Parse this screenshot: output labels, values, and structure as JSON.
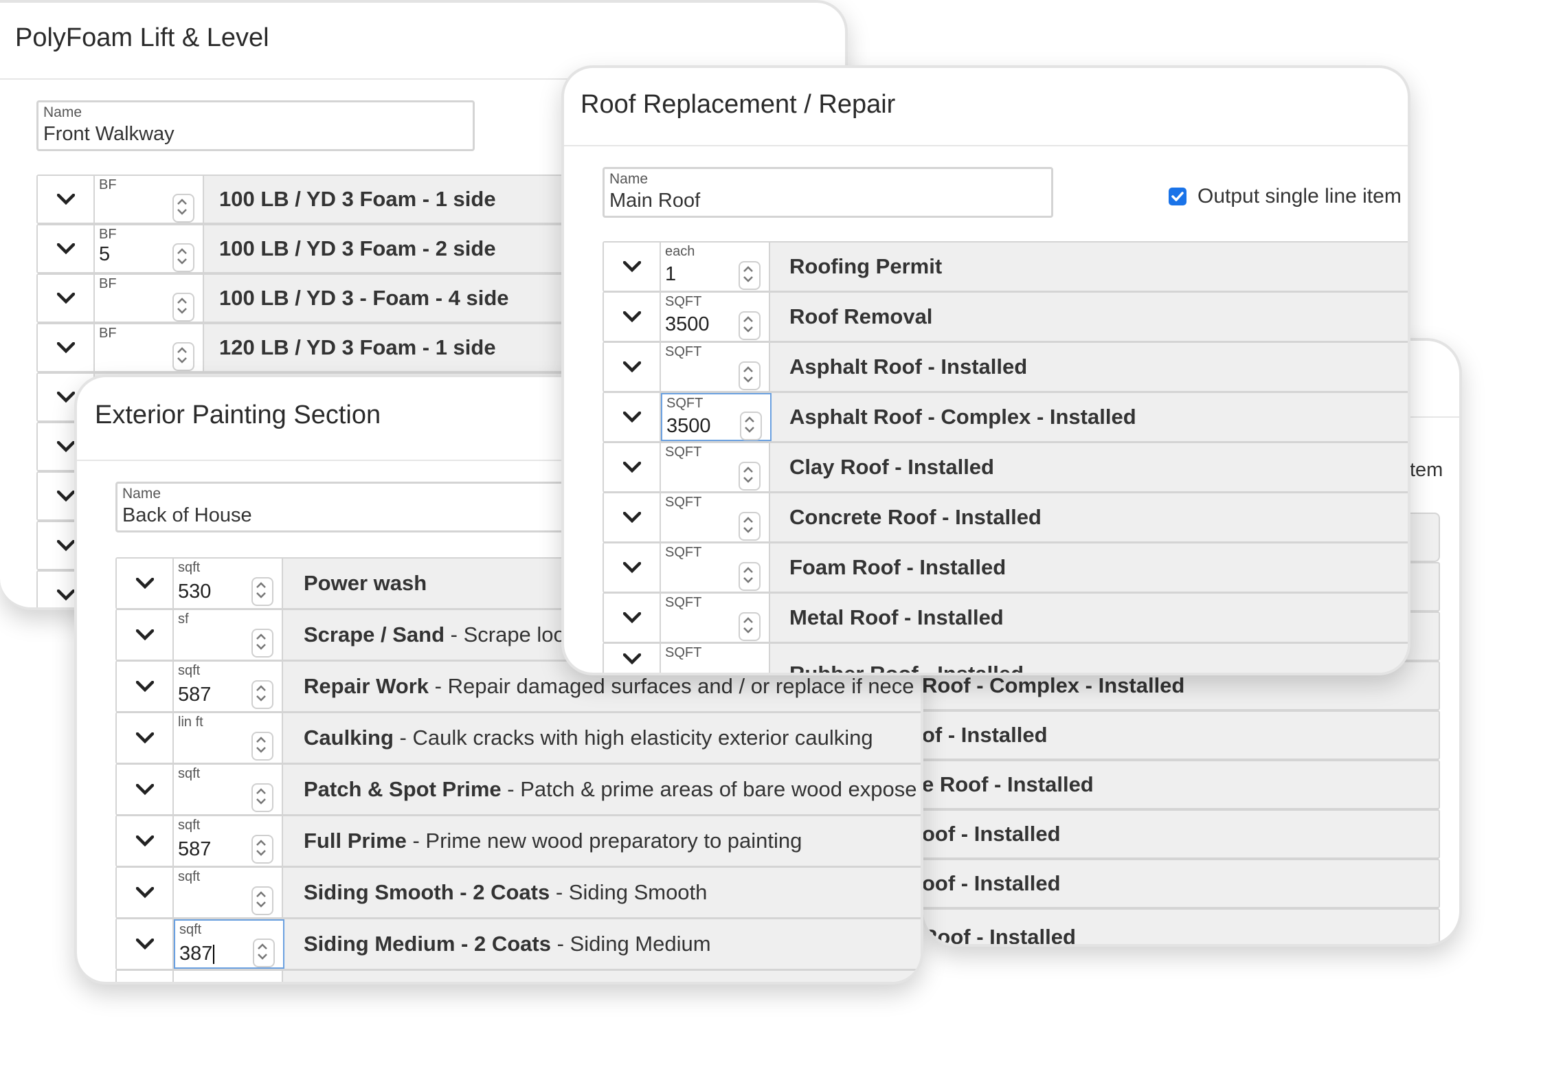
{
  "polyfoam": {
    "title": "PolyFoam Lift & Level",
    "name_label": "Name",
    "name_value": "Front Walkway",
    "rows": [
      {
        "unit": "BF",
        "value": "",
        "label": "100 LB / YD 3 Foam - 1 side"
      },
      {
        "unit": "BF",
        "value": "5",
        "label": "100 LB / YD 3 Foam - 2 side"
      },
      {
        "unit": "BF",
        "value": "",
        "label": "100 LB / YD 3 - Foam - 4 side"
      },
      {
        "unit": "BF",
        "value": "",
        "label": "120 LB / YD 3 Foam - 1 side"
      }
    ]
  },
  "painting": {
    "title": "Exterior Painting Section",
    "name_label": "Name",
    "name_value": "Back of House",
    "rows": [
      {
        "unit": "sqft",
        "value": "530",
        "title": "Power wash",
        "desc": ""
      },
      {
        "unit": "sf",
        "value": "",
        "title": "Scrape / Sand",
        "desc": " - Scrape loo"
      },
      {
        "unit": "sqft",
        "value": "587",
        "title": "Repair Work",
        "desc": " - Repair damaged surfaces and / or replace if nece"
      },
      {
        "unit": "lin ft",
        "value": "",
        "title": "Caulking",
        "desc": " - Caulk cracks with high elasticity exterior caulking"
      },
      {
        "unit": "sqft",
        "value": "",
        "title": "Patch & Spot Prime",
        "desc": " - Patch & prime areas of bare wood expose"
      },
      {
        "unit": "sqft",
        "value": "587",
        "title": "Full Prime",
        "desc": " - Prime new wood preparatory to painting"
      },
      {
        "unit": "sqft",
        "value": "",
        "title": "Siding Smooth - 2 Coats",
        "desc": " - Siding Smooth"
      },
      {
        "unit": "sqft",
        "value": "387",
        "title": "Siding Medium - 2 Coats",
        "desc": " - Siding Medium"
      }
    ]
  },
  "roof": {
    "title": "Roof Replacement / Repair",
    "name_label": "Name",
    "name_value": "Main Roof",
    "checkbox_label": "Output single line item",
    "checkbox_color": "#1a73e8",
    "rows": [
      {
        "unit": "each",
        "value": "1",
        "label": "Roofing Permit"
      },
      {
        "unit": "SQFT",
        "value": "3500",
        "label": "Roof Removal"
      },
      {
        "unit": "SQFT",
        "value": "",
        "label": "Asphalt Roof - Installed"
      },
      {
        "unit": "SQFT",
        "value": "3500",
        "label": "Asphalt Roof - Complex - Installed"
      },
      {
        "unit": "SQFT",
        "value": "",
        "label": "Clay Roof - Installed"
      },
      {
        "unit": "SQFT",
        "value": "",
        "label": "Concrete Roof - Installed"
      },
      {
        "unit": "SQFT",
        "value": "",
        "label": "Foam Roof - Installed"
      },
      {
        "unit": "SQFT",
        "value": "",
        "label": "Metal Roof - Installed"
      },
      {
        "unit": "SQFT",
        "value": "",
        "label": "Rubber Roof - Installed"
      }
    ]
  },
  "back_card": {
    "partial_checkbox_text": "tem",
    "partial_labels": [
      "Roof - Complex - Installed",
      "of - Installed",
      "e Roof - Installed",
      "oof - Installed",
      "oof - Installed",
      "Roof - Installed"
    ]
  }
}
